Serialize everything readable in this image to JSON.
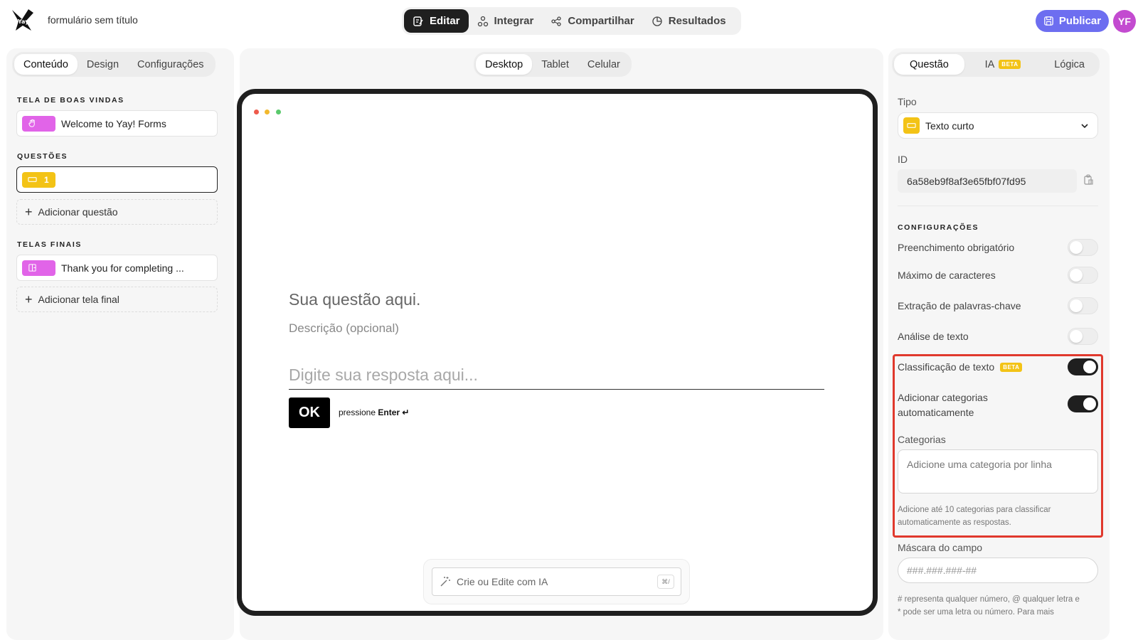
{
  "header": {
    "form_title": "formulário sem título",
    "tabs": [
      {
        "label": "Editar",
        "icon": "edit-icon",
        "active": true
      },
      {
        "label": "Integrar",
        "icon": "integrate-icon",
        "active": false
      },
      {
        "label": "Compartilhar",
        "icon": "share-icon",
        "active": false
      },
      {
        "label": "Resultados",
        "icon": "results-icon",
        "active": false
      }
    ],
    "publish_label": "Publicar",
    "avatar_initials": "YF",
    "accent_color": "#6d6ef0"
  },
  "left": {
    "tabs": [
      {
        "label": "Conteúdo",
        "active": true
      },
      {
        "label": "Design",
        "active": false
      },
      {
        "label": "Configurações",
        "active": false
      }
    ],
    "welcome_section": "TELA DE BOAS VINDAS",
    "welcome_item": "Welcome to Yay! Forms",
    "questions_section": "QUESTÕES",
    "question_number": "1",
    "add_question": "Adicionar questão",
    "endings_section": "TELAS FINAIS",
    "ending_item": "Thank you for completing ...",
    "add_ending": "Adicionar tela final"
  },
  "center": {
    "device_tabs": [
      {
        "label": "Desktop",
        "active": true
      },
      {
        "label": "Tablet",
        "active": false
      },
      {
        "label": "Celular",
        "active": false
      }
    ],
    "question_title": "Sua questão aqui.",
    "question_description": "Descrição (opcional)",
    "answer_placeholder": "Digite sua resposta aqui...",
    "ok_label": "OK",
    "enter_hint_prefix": "pressione",
    "enter_hint_key": "Enter ↵",
    "ai_placeholder": "Crie ou Edite com IA",
    "ai_shortcut": "⌘/"
  },
  "right": {
    "tabs": [
      {
        "label": "Questão",
        "active": true
      },
      {
        "label": "IA",
        "badge": "BETA",
        "active": false
      },
      {
        "label": "Lógica",
        "active": false
      }
    ],
    "type_label": "Tipo",
    "type_value": "Texto curto",
    "id_label": "ID",
    "id_value": "6a58eb9f8af3e65fbf07fd95",
    "settings_section": "CONFIGURAÇÕES",
    "settings": [
      {
        "label": "Preenchimento obrigatório",
        "on": false
      },
      {
        "label": "Máximo de caracteres",
        "on": false
      },
      {
        "label": "Extração de palavras-chave",
        "on": false
      },
      {
        "label": "Análise de texto",
        "on": false
      }
    ],
    "classification": {
      "label": "Classificação de texto",
      "badge": "BETA",
      "on": true
    },
    "auto_categories": {
      "label_line1": "Adicionar categorias",
      "label_line2": "automaticamente",
      "on": true
    },
    "categories_label": "Categorias",
    "categories_placeholder": "Adicione uma categoria por linha",
    "categories_help_line1": "Adicione até 10 categorias para classificar",
    "categories_help_line2": "automaticamente as respostas.",
    "mask_label": "Máscara do campo",
    "mask_placeholder": "###.###.###-##",
    "mask_help_line1": "# representa qualquer número, @ qualquer letra e",
    "mask_help_line2": "* pode ser uma letra ou número. Para mais",
    "highlight_color": "#e0392d"
  }
}
